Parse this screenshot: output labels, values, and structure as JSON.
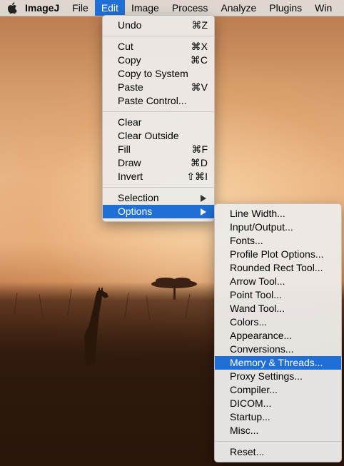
{
  "menubar": {
    "apple_icon": "apple-logo-icon",
    "items": [
      "ImageJ",
      "File",
      "Edit",
      "Image",
      "Process",
      "Analyze",
      "Plugins",
      "Win"
    ],
    "active": "Edit"
  },
  "edit_menu": {
    "groups": [
      [
        {
          "label": "Undo",
          "shortcut": "⌘Z"
        }
      ],
      [
        {
          "label": "Cut",
          "shortcut": "⌘X"
        },
        {
          "label": "Copy",
          "shortcut": "⌘C"
        },
        {
          "label": "Copy to System",
          "shortcut": ""
        },
        {
          "label": "Paste",
          "shortcut": "⌘V"
        },
        {
          "label": "Paste Control...",
          "shortcut": ""
        }
      ],
      [
        {
          "label": "Clear",
          "shortcut": ""
        },
        {
          "label": "Clear Outside",
          "shortcut": ""
        },
        {
          "label": "Fill",
          "shortcut": "⌘F"
        },
        {
          "label": "Draw",
          "shortcut": "⌘D"
        },
        {
          "label": "Invert",
          "shortcut": "⇧⌘I"
        }
      ],
      [
        {
          "label": "Selection",
          "submenu": true
        },
        {
          "label": "Options",
          "submenu": true,
          "highlighted": true
        }
      ]
    ]
  },
  "options_submenu": {
    "groups": [
      [
        "Line Width...",
        "Input/Output...",
        "Fonts...",
        "Profile Plot Options...",
        "Rounded Rect Tool...",
        "Arrow Tool...",
        "Point Tool...",
        "Wand Tool...",
        "Colors...",
        "Appearance...",
        "Conversions...",
        "Memory & Threads...",
        "Proxy Settings...",
        "Compiler...",
        "DICOM...",
        "Startup...",
        "Misc..."
      ],
      [
        "Reset..."
      ]
    ],
    "highlighted": "Memory & Threads..."
  },
  "colors": {
    "highlight": "#1f6fd6",
    "menu_bg": "#ece9e6"
  }
}
